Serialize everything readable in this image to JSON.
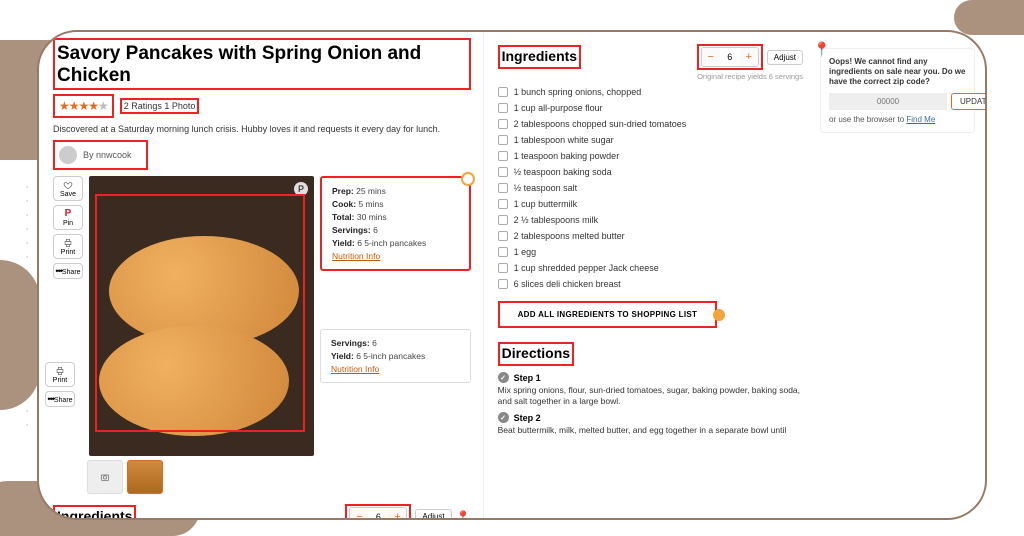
{
  "recipe": {
    "title": "Savory Pancakes with Spring Onion and Chicken",
    "ratingLinks": "2 Ratings  1 Photo",
    "description": "Discovered at a Saturday morning lunch crisis. Hubby loves it and requests it every day for lunch.",
    "authorPrefix": "By ",
    "author": "nnwcook"
  },
  "sideButtons": {
    "save": "Save",
    "pin": "Pin",
    "print": "Print",
    "share": "Share"
  },
  "infoCard1": {
    "prepLabel": "Prep:",
    "prep": "25 mins",
    "cookLabel": "Cook:",
    "cook": "5 mins",
    "totalLabel": "Total:",
    "total": "30 mins",
    "servingsLabel": "Servings:",
    "servings": "6",
    "yieldLabel": "Yield:",
    "yield": "6 5-inch pancakes",
    "nutri": "Nutrition Info"
  },
  "infoCard2": {
    "servingsLabel": "Servings:",
    "servings": "6",
    "yieldLabel": "Yield:",
    "yield": "6 5-inch pancakes",
    "nutri": "Nutrition Info"
  },
  "ingredientsHeader": "Ingredients",
  "servingsValue": "6",
  "adjustLabel": "Adjust",
  "origNote": "Original recipe yields 6 servings",
  "ingredients": [
    "1 bunch spring onions, chopped",
    "1 cup all-purpose flour",
    "2 tablespoons chopped sun-dried tomatoes",
    "1 tablespoon white sugar",
    "1 teaspoon baking powder",
    "½ teaspoon baking soda",
    "½ teaspoon salt",
    "1 cup buttermilk",
    "2 ½ tablespoons milk",
    "2 tablespoons melted butter",
    "1 egg",
    "1 cup shredded pepper Jack cheese",
    "6 slices deli chicken breast"
  ],
  "addAll": "ADD ALL INGREDIENTS TO SHOPPING LIST",
  "directionsHeader": "Directions",
  "steps": [
    {
      "label": "Step 1",
      "body": "Mix spring onions, flour, sun-dried tomatoes, sugar, baking powder, baking soda, and salt together in a large bowl."
    },
    {
      "label": "Step 2",
      "body": "Beat buttermilk, milk, melted butter, and egg together in a separate bowl until"
    }
  ],
  "loc": {
    "oops": "Oops! We cannot find any ingredients on sale near you. Do we have the correct zip code?",
    "zip": "00000",
    "update": "UPDATE",
    "findPrefix": "or use the browser to ",
    "findMe": "Find Me"
  }
}
